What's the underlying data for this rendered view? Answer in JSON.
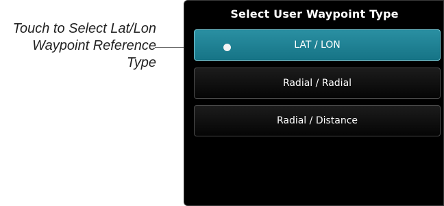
{
  "callout": {
    "lines": [
      "Touch to Select Lat/Lon",
      "Waypoint Reference",
      "Type"
    ]
  },
  "dialog": {
    "title": "Select User Waypoint Type",
    "options": [
      {
        "label": "LAT / LON",
        "selected": true
      },
      {
        "label": "Radial / Radial",
        "selected": false
      },
      {
        "label": "Radial / Distance",
        "selected": false
      }
    ]
  },
  "colors": {
    "selected": "#1f8597",
    "panel": "#000000"
  }
}
